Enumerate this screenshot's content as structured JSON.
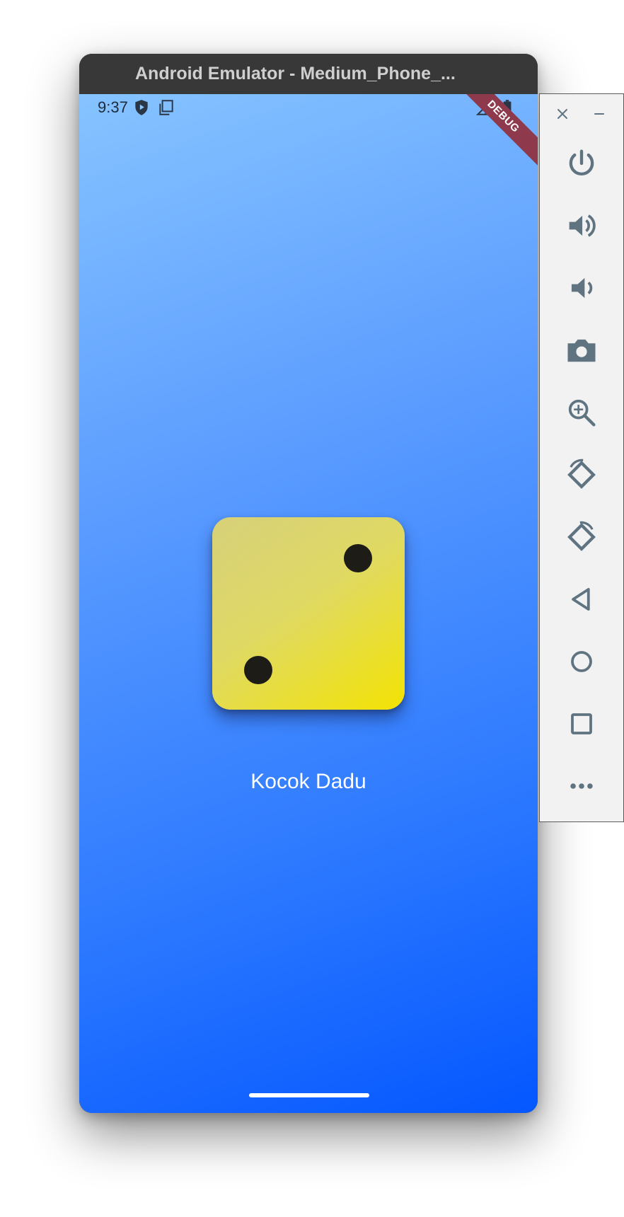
{
  "window": {
    "title": "Android Emulator - Medium_Phone_..."
  },
  "status_bar": {
    "time": "9:37",
    "icons": [
      "shield-play-icon",
      "copy-icon",
      "signal-icon",
      "battery-icon"
    ]
  },
  "debug_banner": {
    "label": "DEBUG"
  },
  "app": {
    "die": {
      "value": 2,
      "color_top": "#d7d07a",
      "color_bottom": "#f3e304",
      "pip_color": "#1d1c17"
    },
    "roll_label": "Kocok Dadu",
    "background_top": "#86c3ff",
    "background_bottom": "#0457ff"
  },
  "side_panel": {
    "window_controls": [
      "close-icon",
      "minimize-icon"
    ],
    "buttons": [
      {
        "name": "power-button",
        "icon": "power-icon"
      },
      {
        "name": "volume-up-button",
        "icon": "volume-up-icon"
      },
      {
        "name": "volume-down-button",
        "icon": "volume-down-icon"
      },
      {
        "name": "screenshot-button",
        "icon": "camera-icon"
      },
      {
        "name": "zoom-button",
        "icon": "zoom-in-icon"
      },
      {
        "name": "rotate-left-button",
        "icon": "rotate-left-icon"
      },
      {
        "name": "rotate-right-button",
        "icon": "rotate-right-icon"
      },
      {
        "name": "back-button",
        "icon": "back-triangle-icon"
      },
      {
        "name": "home-button",
        "icon": "home-circle-icon"
      },
      {
        "name": "overview-button",
        "icon": "overview-square-icon"
      },
      {
        "name": "more-button",
        "icon": "more-dots-icon"
      }
    ],
    "icon_color": "#5f7381"
  }
}
